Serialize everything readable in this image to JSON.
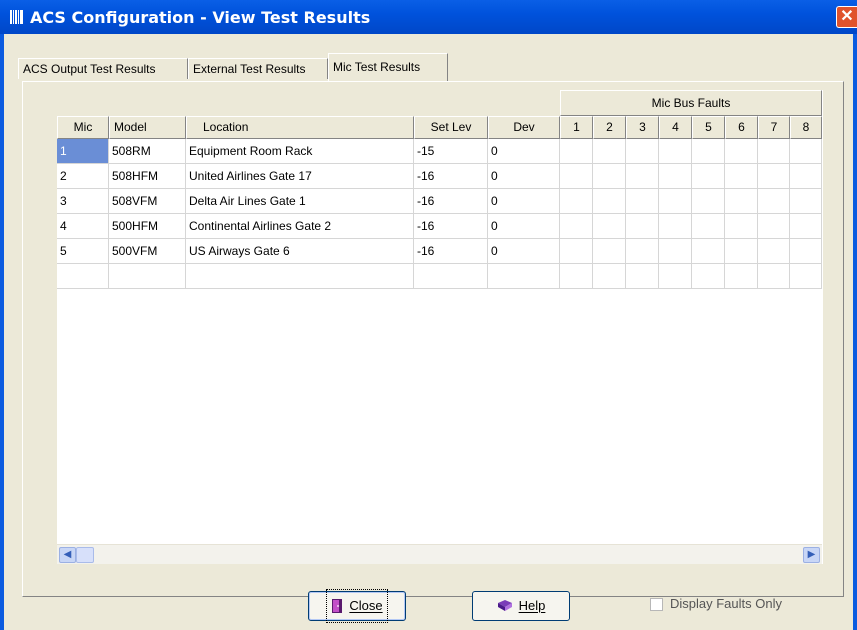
{
  "window": {
    "title": "ACS Configuration - View Test Results"
  },
  "tabs": [
    {
      "label": "ACS Output Test Results"
    },
    {
      "label": "External Test Results"
    },
    {
      "label": "Mic Test Results"
    }
  ],
  "table": {
    "group_header": "Mic Bus Faults",
    "columns": [
      "Mic",
      "Model",
      "Location",
      "Set Lev",
      "Dev",
      "1",
      "2",
      "3",
      "4",
      "5",
      "6",
      "7",
      "8"
    ],
    "rows": [
      {
        "mic": "1",
        "model": "508RM",
        "location": "Equipment Room Rack",
        "set_lev": "-15",
        "dev": "0"
      },
      {
        "mic": "2",
        "model": "508HFM",
        "location": "United Airlines Gate 17",
        "set_lev": "-16",
        "dev": "0"
      },
      {
        "mic": "3",
        "model": "508VFM",
        "location": "Delta Air Lines Gate 1",
        "set_lev": "-16",
        "dev": "0"
      },
      {
        "mic": "4",
        "model": "500HFM",
        "location": "Continental Airlines Gate 2",
        "set_lev": "-16",
        "dev": "0"
      },
      {
        "mic": "5",
        "model": "500VFM",
        "location": "US Airways Gate 6",
        "set_lev": "-16",
        "dev": "0"
      }
    ]
  },
  "buttons": {
    "close": "Close",
    "help": "Help"
  },
  "display_faults_only": {
    "label": "Display Faults Only",
    "checked": false
  },
  "colors": {
    "titlebar": "#0052dc",
    "selection": "#6a8ed6",
    "dialog": "#ece9d8"
  }
}
